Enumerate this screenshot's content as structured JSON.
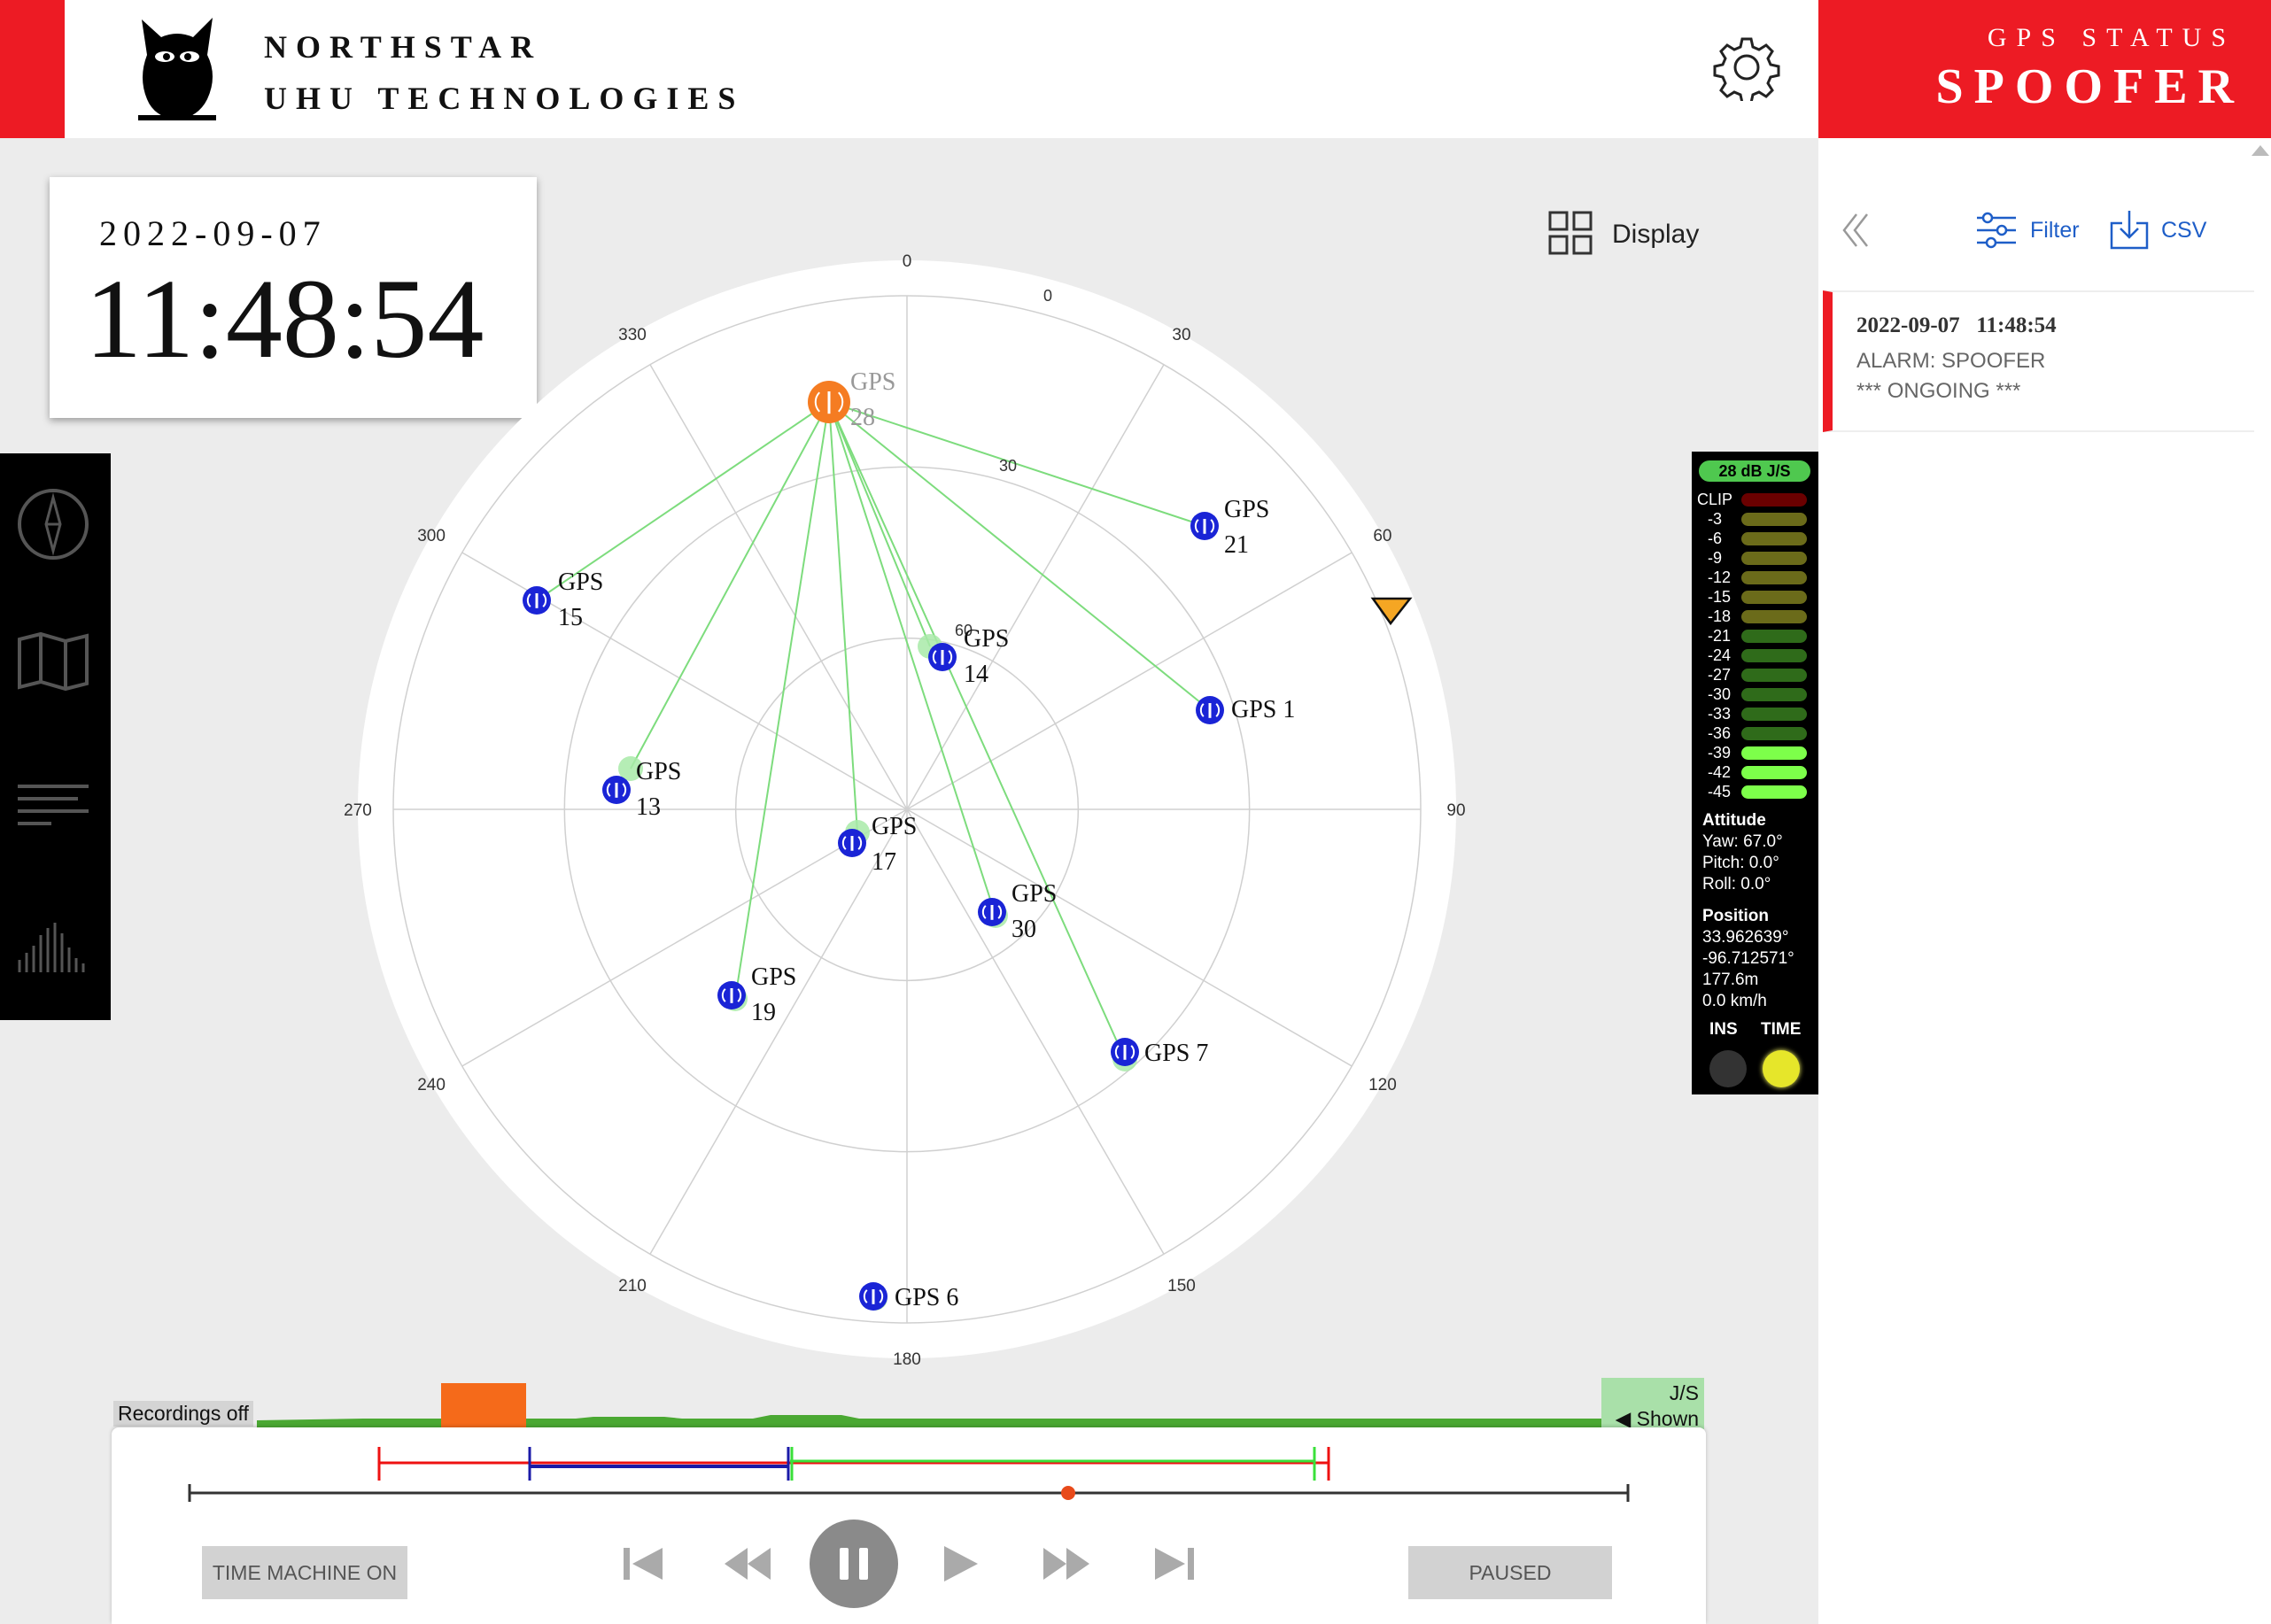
{
  "header": {
    "brand_line1": "NORTHSTAR",
    "brand_line2": "UHU TECHNOLOGIES",
    "status_label": "GPS STATUS",
    "status_value": "SPOOFER",
    "accent_color": "#ed1b24"
  },
  "clock": {
    "date": "2022-09-07",
    "time": "11:48:54"
  },
  "display_button": {
    "label": "Display"
  },
  "side_panel": {
    "filter_label": "Filter",
    "csv_label": "CSV",
    "alarm": {
      "timestamp": "2022-09-07   11:48:54",
      "type": "ALARM: SPOOFER",
      "state": "*** ONGOING ***"
    }
  },
  "skyplot": {
    "azimuth_labels": [
      "0",
      "30",
      "60",
      "90",
      "120",
      "150",
      "180",
      "210",
      "240",
      "270",
      "300",
      "330"
    ],
    "elevation_labels": [
      "0",
      "30",
      "60"
    ],
    "satellites": [
      {
        "label_line1": "GPS",
        "label_line2": "28",
        "spoofer_source": true
      },
      {
        "label_line1": "GPS",
        "label_line2": "21"
      },
      {
        "label_line1": "GPS",
        "label_line2": "15"
      },
      {
        "label_line1": "GPS",
        "label_line2": "14"
      },
      {
        "label_line1": "GPS 1",
        "label_line2": ""
      },
      {
        "label_line1": "GPS",
        "label_line2": "13"
      },
      {
        "label_line1": "GPS",
        "label_line2": "17"
      },
      {
        "label_line1": "GPS",
        "label_line2": "30"
      },
      {
        "label_line1": "GPS",
        "label_line2": "19"
      },
      {
        "label_line1": "GPS 7",
        "label_line2": ""
      },
      {
        "label_line1": "GPS 6",
        "label_line2": ""
      }
    ],
    "colors": {
      "satellite": "#1a24d6",
      "spoofer": "#f57c22",
      "link_line": "#7ddc7d",
      "heading": "#f5a623"
    }
  },
  "meter": {
    "badge": "28 dB J/S",
    "scale": [
      "CLIP",
      "-3",
      "-6",
      "-9",
      "-12",
      "-15",
      "-18",
      "-21",
      "-24",
      "-27",
      "-30",
      "-33",
      "-36",
      "-39",
      "-42",
      "-45"
    ],
    "bar_colors": [
      "#6b0000",
      "#6b6b1a",
      "#6b6b1a",
      "#6b6b1a",
      "#6b6b1a",
      "#6b6b1a",
      "#6b6b1a",
      "#2f6b1a",
      "#2f6b1a",
      "#2f6b1a",
      "#2f6b1a",
      "#2f6b1a",
      "#2f6b1a",
      "#7dff4a",
      "#7dff4a",
      "#7dff4a"
    ],
    "attitude_title": "Attitude",
    "yaw": "Yaw: 67.0°",
    "pitch": "Pitch: 0.0°",
    "roll": "Roll: 0.0°",
    "position_title": "Position",
    "lat": "33.962639°",
    "lon": "-96.712571°",
    "alt": "177.6m",
    "speed": "0.0 km/h",
    "ins_label": "INS",
    "time_label": "TIME",
    "ins_on": false,
    "time_on": true
  },
  "timeline": {
    "recordings": "Recordings off",
    "js_line1": "J/S",
    "js_line2": "◀ Shown",
    "time_machine": "TIME MACHINE ON",
    "paused": "PAUSED"
  }
}
